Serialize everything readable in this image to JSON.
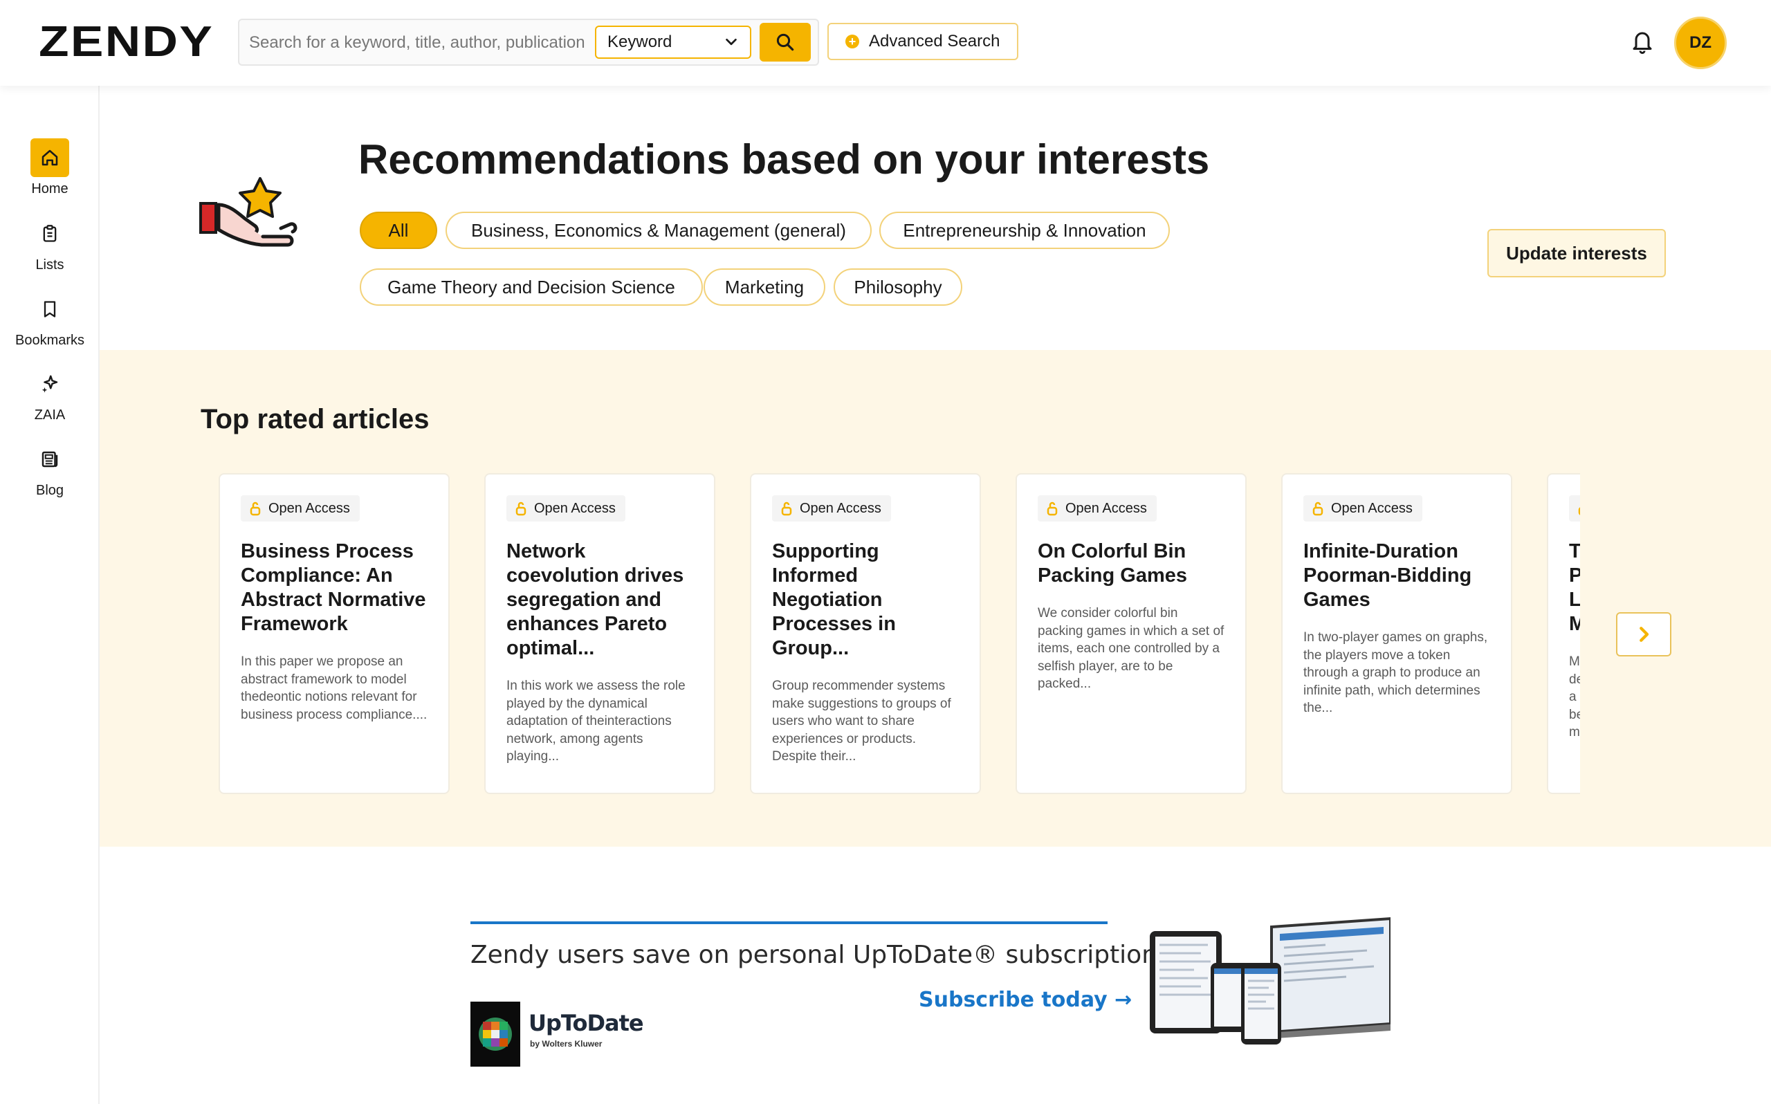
{
  "header": {
    "logo": "ZENDY",
    "search_placeholder": "Search for a keyword, title, author, publication",
    "search_type": "Keyword",
    "advanced_search": "Advanced Search",
    "avatar_initials": "DZ"
  },
  "sidebar": {
    "items": [
      {
        "label": "Home",
        "icon": "home-icon",
        "active": true
      },
      {
        "label": "Lists",
        "icon": "clipboard-icon"
      },
      {
        "label": "Bookmarks",
        "icon": "bookmark-icon"
      },
      {
        "label": "ZAIA",
        "icon": "sparkle-icon"
      },
      {
        "label": "Blog",
        "icon": "newspaper-icon"
      }
    ]
  },
  "hero": {
    "title": "Recommendations based on your interests",
    "chips": [
      "All",
      "Business, Economics & Management (general)",
      "Entrepreneurship & Innovation",
      "Game Theory and Decision Science",
      "Marketing",
      "Philosophy"
    ],
    "update_button": "Update interests"
  },
  "top_rated": {
    "title": "Top rated articles",
    "badge": "Open Access",
    "cards": [
      {
        "title": "Business Process Compliance: An Abstract Normative Framework",
        "abstract": "In this paper we propose an abstract framework to model thedeontic notions relevant for business process compliance...."
      },
      {
        "title": "Network coevolution drives segregation and enhances Pareto optimal...",
        "abstract": "In this work we assess the role played by the dynamical adaptation of theinteractions network, among agents playing..."
      },
      {
        "title": "Supporting Informed Negotiation Processes in Group...",
        "abstract": "Group recommender systems make suggestions to groups of users who want to share experiences or products. Despite their..."
      },
      {
        "title": "On Colorful Bin Packing Games",
        "abstract": "We consider colorful bin packing games in which a set of items, each one controlled by a selfish player, are to be packed..."
      },
      {
        "title": "Infinite-Duration Poorman-Bidding Games",
        "abstract": "In two-player games on graphs, the players move a token through a graph to produce an infinite path, which determines the..."
      },
      {
        "title": "T P L M",
        "abstract": "M de a be m"
      }
    ]
  },
  "ad": {
    "headline": "Zendy users save on personal UpToDate® subscriptions",
    "cta": "Subscribe today →",
    "brand": "UpToDate",
    "brand_sub": "by Wolters Kluwer"
  },
  "colors": {
    "accent": "#f5b400",
    "band": "#fef7e6",
    "link_blue": "#1976c8"
  }
}
